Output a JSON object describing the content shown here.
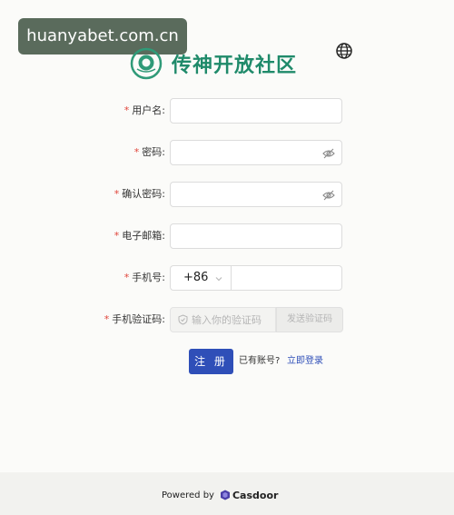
{
  "watermark": "huanyabet.com.cn",
  "brand": {
    "name": "传神开放社区"
  },
  "form": {
    "username": {
      "required_mark": "*",
      "label": "用户名:",
      "value": ""
    },
    "password": {
      "required_mark": "*",
      "label": "密码:",
      "value": ""
    },
    "confirm_password": {
      "required_mark": "*",
      "label": "确认密码:",
      "value": ""
    },
    "email": {
      "required_mark": "*",
      "label": "电子邮箱:",
      "value": ""
    },
    "phone": {
      "required_mark": "*",
      "label": "手机号:",
      "country_code": "+86",
      "value": ""
    },
    "verification": {
      "required_mark": "*",
      "label": "手机验证码:",
      "placeholder": "输入你的验证码",
      "send_button": "发送验证码"
    }
  },
  "actions": {
    "submit": "注 册",
    "has_account": "已有账号?",
    "login_link": "立即登录"
  },
  "footer": {
    "powered_by": "Powered by",
    "brand": "Casdoor"
  },
  "colors": {
    "accent": "#2f4fb8",
    "brand_green": "#1f8a6a",
    "required": "#e0443a"
  }
}
